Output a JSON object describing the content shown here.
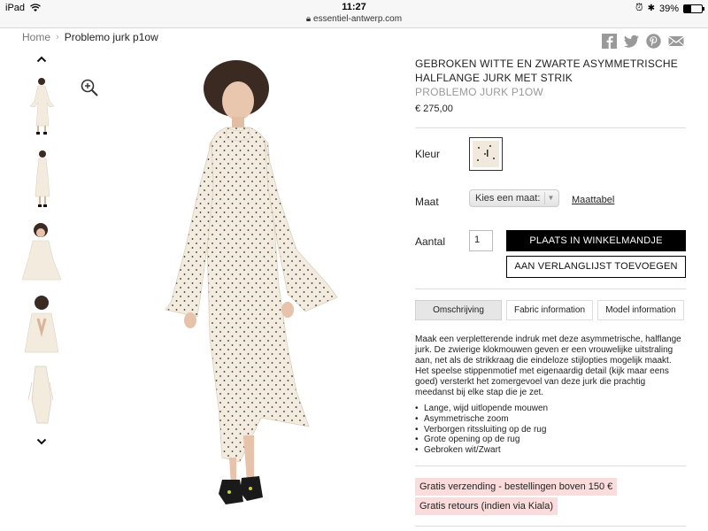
{
  "status_bar": {
    "device": "iPad",
    "time": "11:27",
    "url": "essentiel-antwerp.com",
    "battery": "39%",
    "battery_level": 0.39
  },
  "breadcrumb": {
    "home": "Home",
    "current": "Problemo jurk p1ow"
  },
  "share_icons": [
    "facebook-icon",
    "twitter-icon",
    "pinterest-icon",
    "mail-icon"
  ],
  "product": {
    "title": "GEBROKEN WITTE EN ZWARTE ASYMMETRISCHE HALFLANGE JURK MET STRIK",
    "sku": "PROBLEMO JURK P1OW",
    "price": "€ 275,00"
  },
  "options": {
    "color_label": "Kleur",
    "size_label": "Maat",
    "size_select": "Kies een maat:",
    "size_table": "Maattabel",
    "quantity_label": "Aantal",
    "quantity": "1"
  },
  "buttons": {
    "add_to_cart": "PLAATS IN WINKELMANDJE",
    "add_to_wishlist": "AAN VERLANGLIJST TOEVOEGEN"
  },
  "tabs": [
    {
      "label": "Omschrijving",
      "active": true
    },
    {
      "label": "Fabric information",
      "active": false
    },
    {
      "label": "Model information",
      "active": false
    }
  ],
  "description": "Maak een verpletterende indruk met deze asymmetrische, halflange jurk. De zwierige klokmouwen geven er een vrouwelijke uitstraling aan, net als de strikkraag die eindeloze stijlopties mogelijk maakt. Het speelse stippenmotief met eigenaardig detail (kijk maar eens goed) versterkt het zomergevoel van deze jurk die prachtig meedanst bij elke stap die je zet.",
  "features": [
    "Lange, wijd uitlopende mouwen",
    "Asymmetrische zoom",
    "Verborgen ritssluiting op de rug",
    "Grote opening op de rug",
    "Gebroken wit/Zwart"
  ],
  "promos": [
    "Gratis verzending - bestellingen boven 150 €",
    "Gratis retours (indien via Kiala)"
  ],
  "colors": {
    "dress": "#f3ebde",
    "dots": "#2b2b2b",
    "promo_bg": "#fbdcdc",
    "button_bg": "#000000"
  }
}
